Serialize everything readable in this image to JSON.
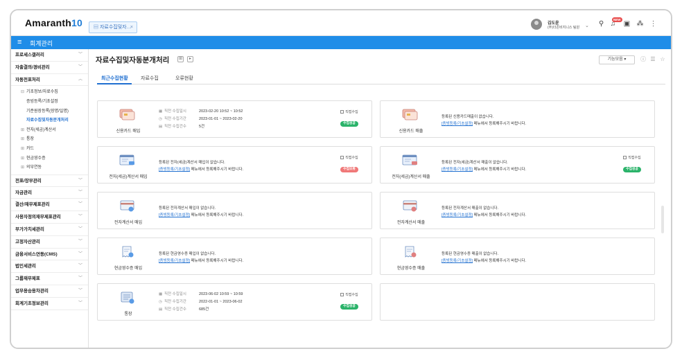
{
  "app": {
    "logo_text": "Amaranth",
    "logo_num": "10"
  },
  "tab": {
    "label": "자료수집및자…",
    "close": "×"
  },
  "user": {
    "name": "김도윤",
    "org": "(주)더존비지니스 팀원"
  },
  "header_icons": [
    "search-icon",
    "bell-icon",
    "help-icon",
    "org-chart-icon",
    "more-icon"
  ],
  "badge": "NEW",
  "module": {
    "title": "회계관리"
  },
  "sidebar": {
    "top_sections": [
      "프로세스갤러리",
      "자출결의/경비관리",
      "자동전표처리"
    ],
    "sub": [
      {
        "label": "기초정보/자료수집",
        "pm": "⊟",
        "lvl": 1
      },
      {
        "label": "증빙등록/기초설정",
        "lvl": 2
      },
      {
        "label": "기준원장등록(장명/일명)",
        "lvl": 2
      },
      {
        "label": "자료수집및자동분개처리",
        "lvl": 2,
        "active": true
      },
      {
        "label": "전자(세금)계산서",
        "pm": "⊞",
        "lvl": 1
      },
      {
        "label": "통장",
        "pm": "⊞",
        "lvl": 1
      },
      {
        "label": "카드",
        "pm": "⊞",
        "lvl": 1
      },
      {
        "label": "현금영수증",
        "pm": "⊞",
        "lvl": 1
      },
      {
        "label": "의부연동",
        "pm": "⊞",
        "lvl": 1
      }
    ],
    "bottom_sections": [
      "전표/장부관리",
      "자금관리",
      "결산/재무제표관리",
      "사용자정의재무제표관리",
      "부가가치세관리",
      "고정자산관리",
      "금융서비스연동(CMS)",
      "법인세관리",
      "그룹재무제표",
      "업무용승용차관리",
      "회계기초정보관리"
    ]
  },
  "page": {
    "title": "자료수집및자동분개처리",
    "fn_button": "기능모음 ▾"
  },
  "tabs": [
    "최근수집현황",
    "자료수집",
    "오류현황"
  ],
  "labels": {
    "collect_dt": "직전 수집일시",
    "collect_period": "직전 수집기간",
    "collect_count": "직전 수집건수",
    "status_label": "직접수집"
  },
  "cards": [
    {
      "label": "신용카드 매입",
      "mode": "info",
      "date": "2023-02-20 10:52 ~ 10:52",
      "period": "2023-01-01 ~ 2023-02-20",
      "count": "5건",
      "status": "수집성공",
      "status_type": "ok"
    },
    {
      "label": "신용카드 매출",
      "mode": "empty",
      "msg1": "등록된 신용카드매출이 없습니다.",
      "msg_link": "[증빙등록/기초설정]",
      "msg2": " 메뉴에서 등록해주시기 바랍니다."
    },
    {
      "label": "전자(세금)계산서 매입",
      "mode": "empty",
      "msg1": "등록된 전자(세금)계산서 매입이 없습니다.",
      "msg_link": "[증빙등록/기초설정]",
      "msg2": " 메뉴에서 등록해주시기 바랍니다.",
      "status": "수집오류",
      "status_type": "fail"
    },
    {
      "label": "전자(세금)계산서 매출",
      "mode": "empty",
      "msg1": "등록된 전자(세금)계산서 매출이 없습니다.",
      "msg_link": "[증빙등록/기초설정]",
      "msg2": " 메뉴에서 등록해주시기 바랍니다.",
      "status": "수집성공",
      "status_type": "ok"
    },
    {
      "label": "전자계산서 매입",
      "mode": "empty",
      "msg1": "등록된 전자계산서 매입이 없습니다.",
      "msg_link": "[증빙등록/기초설정]",
      "msg2": " 메뉴에서 등록해주시기 바랍니다."
    },
    {
      "label": "전자계산서 매출",
      "mode": "empty",
      "msg1": "등록된 전자계산서 매출이 없습니다.",
      "msg_link": "[증빙등록/기초설정]",
      "msg2": " 메뉴에서 등록해주시기 바랍니다."
    },
    {
      "label": "현금영수증 매입",
      "mode": "empty",
      "msg1": "등록된 현금영수증 매입이 없습니다.",
      "msg_link": "[증빙등록/기초설정]",
      "msg2": " 메뉴에서 등록해주시기 바랍니다."
    },
    {
      "label": "현금영수증 매출",
      "mode": "empty",
      "msg1": "등록된 현금영수증 매출이 없습니다.",
      "msg_link": "[증빙등록/기초설정]",
      "msg2": " 메뉴에서 등록해주시기 바랍니다."
    },
    {
      "label": "통장",
      "mode": "info",
      "date": "2023-06-02 10:59 ~ 10:59",
      "period": "2022-01-01 ~ 2023-06-02",
      "count": "685건",
      "status": "수집성공",
      "status_type": "ok"
    },
    {
      "label": "",
      "mode": "blank"
    }
  ],
  "colors": {
    "brand_blue": "#1f8de8",
    "link": "#1f6fd0",
    "ok": "#2bb36a",
    "fail": "#f07878"
  }
}
